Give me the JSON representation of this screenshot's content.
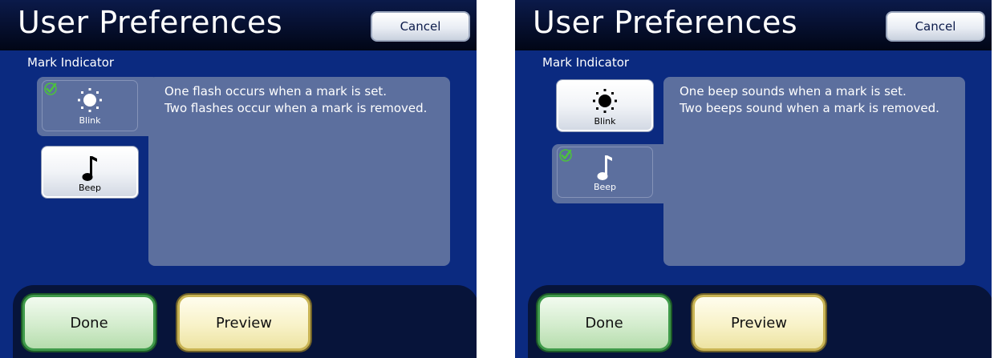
{
  "colors": {
    "screen_bg": "#0b2a80",
    "title_bar": "#010616",
    "panel": "#5c6f9e",
    "check": "#4cc23c",
    "done_border": "#3f9a4a",
    "preview_border": "#c9b454"
  },
  "screens": [
    {
      "title": "User Preferences",
      "cancel_label": "Cancel",
      "section_label": "Mark Indicator",
      "selected": "blink",
      "options": [
        {
          "id": "blink",
          "label": "Blink",
          "icon": "sun-icon",
          "selected": true
        },
        {
          "id": "beep",
          "label": "Beep",
          "icon": "music-note-icon",
          "selected": false
        }
      ],
      "description": [
        "One flash occurs when a mark is set.",
        "Two flashes occur when a mark is removed."
      ],
      "done_label": "Done",
      "preview_label": "Preview"
    },
    {
      "title": "User Preferences",
      "cancel_label": "Cancel",
      "section_label": "Mark Indicator",
      "selected": "beep",
      "options": [
        {
          "id": "blink",
          "label": "Blink",
          "icon": "sun-icon",
          "selected": false
        },
        {
          "id": "beep",
          "label": "Beep",
          "icon": "music-note-icon",
          "selected": true
        }
      ],
      "description": [
        "One beep sounds when a mark is set.",
        "Two beeps sound when a mark is removed."
      ],
      "done_label": "Done",
      "preview_label": "Preview"
    }
  ]
}
